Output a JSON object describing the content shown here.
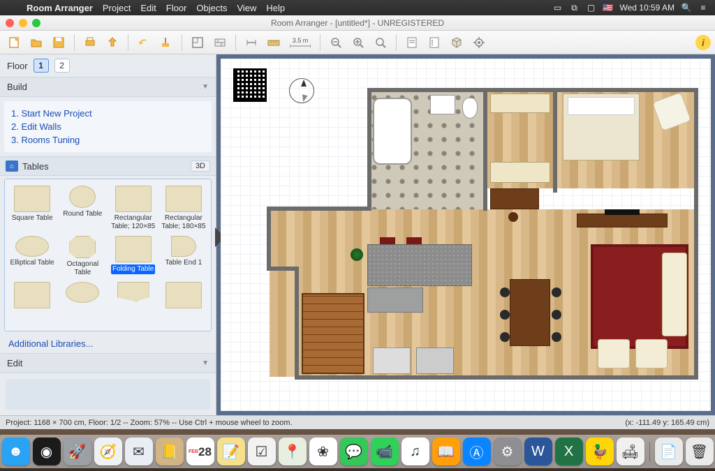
{
  "menubar": {
    "app": "Room Arranger",
    "items": [
      "Project",
      "Edit",
      "Floor",
      "Objects",
      "View",
      "Help"
    ],
    "clock": "Wed 10:59 AM"
  },
  "window": {
    "title": "Room Arranger - [untitled*] - UNREGISTERED"
  },
  "toolbar": {
    "ruler_label": "3.5 m"
  },
  "sidebar": {
    "floor_label": "Floor",
    "floors": [
      "1",
      "2"
    ],
    "active_floor": "1",
    "build_label": "Build",
    "build_steps": [
      "1. Start New Project",
      "2. Edit Walls",
      "3. Rooms Tuning"
    ],
    "library_name": "Tables",
    "threed_label": "3D",
    "tables": [
      {
        "label": "Square Table",
        "shape": "sq"
      },
      {
        "label": "Round Table",
        "shape": "round"
      },
      {
        "label": "Rectangular Table; 120×85",
        "shape": "rect"
      },
      {
        "label": "Rectangular Table; 180×85",
        "shape": "rect"
      },
      {
        "label": "Elliptical Table",
        "shape": "oval"
      },
      {
        "label": "Octagonal Table",
        "shape": "octa"
      },
      {
        "label": "Folding Table",
        "shape": "rect",
        "selected": true
      },
      {
        "label": "Table End 1",
        "shape": "end"
      },
      {
        "label": "",
        "shape": "rect"
      },
      {
        "label": "",
        "shape": "oval"
      },
      {
        "label": "",
        "shape": "wedge"
      },
      {
        "label": "",
        "shape": "sq"
      }
    ],
    "additional": "Additional Libraries...",
    "edit_label": "Edit"
  },
  "status": {
    "left": "Project: 1168 × 700 cm, Floor: 1/2 -- Zoom: 57% -- Use Ctrl + mouse wheel to zoom.",
    "right": "(x: -111.49 y: 165.49 cm)"
  },
  "dock": {
    "items": [
      {
        "name": "finder",
        "bg": "#2aa3f4",
        "glyph": "☻"
      },
      {
        "name": "siri",
        "bg": "#1b1b1b",
        "glyph": "◉"
      },
      {
        "name": "launchpad",
        "bg": "#9aa0a6",
        "glyph": "🚀"
      },
      {
        "name": "safari",
        "bg": "#eef2f6",
        "glyph": "🧭"
      },
      {
        "name": "mail",
        "bg": "#e9eef4",
        "glyph": "✉"
      },
      {
        "name": "contacts",
        "bg": "#d4b483",
        "glyph": "📒"
      },
      {
        "name": "calendar",
        "bg": "#fff",
        "glyph": "28"
      },
      {
        "name": "notes",
        "bg": "#f7e08a",
        "glyph": "📝"
      },
      {
        "name": "reminders",
        "bg": "#f2f2f2",
        "glyph": "☑"
      },
      {
        "name": "maps",
        "bg": "#e7efe0",
        "glyph": "📍"
      },
      {
        "name": "photos",
        "bg": "#fff",
        "glyph": "❀"
      },
      {
        "name": "messages",
        "bg": "#34c759",
        "glyph": "💬"
      },
      {
        "name": "facetime",
        "bg": "#30d158",
        "glyph": "📹"
      },
      {
        "name": "itunes",
        "bg": "#fff",
        "glyph": "♫"
      },
      {
        "name": "ibooks",
        "bg": "#ff9f0a",
        "glyph": "📖"
      },
      {
        "name": "appstore",
        "bg": "#0a84ff",
        "glyph": "Ⓐ"
      },
      {
        "name": "preferences",
        "bg": "#8e8e93",
        "glyph": "⚙"
      },
      {
        "name": "word",
        "bg": "#2b579a",
        "glyph": "W"
      },
      {
        "name": "excel",
        "bg": "#217346",
        "glyph": "X"
      },
      {
        "name": "cyberduck",
        "bg": "#ffd60a",
        "glyph": "🦆"
      },
      {
        "name": "roomarranger",
        "bg": "#f0f0f0",
        "glyph": "🛋"
      }
    ],
    "right_items": [
      {
        "name": "documents",
        "bg": "#eaeaea",
        "glyph": "📄"
      },
      {
        "name": "trash",
        "bg": "#eaeaea",
        "glyph": "🗑"
      }
    ]
  }
}
